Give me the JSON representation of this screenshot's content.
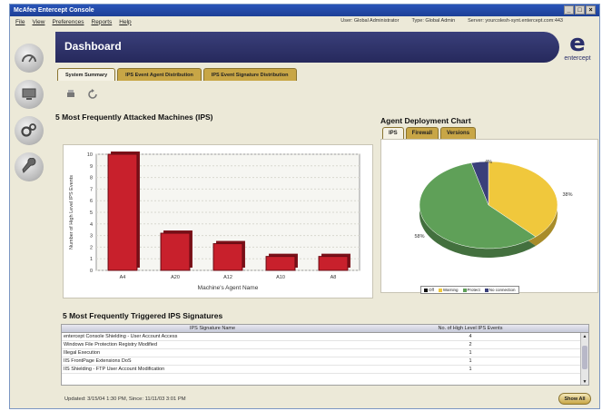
{
  "window": {
    "title": "McAfee Entercept Console"
  },
  "menu": [
    "File",
    "View",
    "Preferences",
    "Reports",
    "Help"
  ],
  "session": {
    "user": "User: Global Administrator",
    "type": "Type: Global Admin",
    "server": "Server: yourcolesh-synt.entercept.com:443"
  },
  "header": {
    "title": "Dashboard"
  },
  "logo": {
    "mark": "e",
    "text": "entercept"
  },
  "tabs": [
    "System Summary",
    "IPS Event Agent Distribution",
    "IPS Event Signature Distribution"
  ],
  "attacked": {
    "title": "5 Most Frequently Attacked Machines (IPS)"
  },
  "chart_data": {
    "type": "bar",
    "categories": [
      "A4",
      "A20",
      "A12",
      "A10",
      "A8"
    ],
    "values": [
      10,
      3.2,
      2.3,
      1.2,
      1.2
    ],
    "xlabel": "Machine's Agent Name",
    "ylabel": "Number of High Level IPS Events",
    "ylim": [
      0,
      10
    ],
    "yticks": [
      "0",
      "1",
      "2",
      "3",
      "4",
      "5",
      "6",
      "7",
      "8",
      "9",
      "10"
    ],
    "bar_color": "#c8202c",
    "grid": true
  },
  "agent": {
    "title": "Agent Deployment Chart",
    "tabs": [
      "IPS",
      "Firewall",
      "Versions"
    ],
    "pie": {
      "type": "pie",
      "slices": [
        {
          "name": "Off",
          "value": 0,
          "color": "#111111"
        },
        {
          "name": "Warning",
          "value": 38,
          "color": "#f0c83c"
        },
        {
          "name": "Protect",
          "value": 58,
          "color": "#5fa058"
        },
        {
          "name": "No connection",
          "value": 4,
          "color": "#3a3f7a"
        }
      ],
      "labels": [
        "4%",
        "38%",
        "58%"
      ]
    }
  },
  "signatures": {
    "title": "5 Most Frequently Triggered IPS Signatures",
    "columns": [
      "IPS Signature Name",
      "No. of High Level IPS Events"
    ],
    "rows": [
      {
        "name": "entercept Console Shielding - User Account Access",
        "count": "4"
      },
      {
        "name": "Windows File Protection Registry Modified",
        "count": "2"
      },
      {
        "name": "Illegal Execution",
        "count": "1"
      },
      {
        "name": "IIS FrontPage Extensions DoS",
        "count": "1"
      },
      {
        "name": "IIS Shielding - FTP User Account Modification",
        "count": "1"
      }
    ]
  },
  "footer": {
    "updated": "Updated: 3/15/04 1:30 PM,  Since: 11/11/03 3:01 PM",
    "show_all": "Show All"
  }
}
